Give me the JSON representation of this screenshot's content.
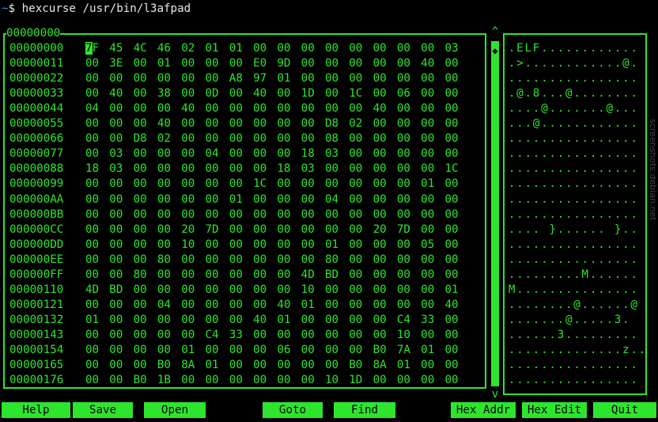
{
  "prompt": {
    "tilde": "~",
    "text": "$ hexcurse /usr/bin/l3afpad"
  },
  "hex_view": {
    "title": "00000000",
    "cursor": {
      "row": 0,
      "byte": 0,
      "char": "7"
    },
    "rows": [
      {
        "addr": "00000000",
        "bytes": [
          "7F",
          "45",
          "4C",
          "46",
          "02",
          "01",
          "01",
          "00",
          "00",
          "00",
          "00",
          "00",
          "00",
          "00",
          "00",
          "03"
        ],
        "ascii": ".ELF............"
      },
      {
        "addr": "00000011",
        "bytes": [
          "00",
          "3E",
          "00",
          "01",
          "00",
          "00",
          "00",
          "E0",
          "9D",
          "00",
          "00",
          "00",
          "00",
          "00",
          "40",
          "00"
        ],
        "ascii": ".>............@."
      },
      {
        "addr": "00000022",
        "bytes": [
          "00",
          "00",
          "00",
          "00",
          "00",
          "00",
          "A8",
          "97",
          "01",
          "00",
          "00",
          "00",
          "00",
          "00",
          "00",
          "00"
        ],
        "ascii": "................"
      },
      {
        "addr": "00000033",
        "bytes": [
          "00",
          "40",
          "00",
          "38",
          "00",
          "0D",
          "00",
          "40",
          "00",
          "1D",
          "00",
          "1C",
          "00",
          "06",
          "00",
          "00"
        ],
        "ascii": ".@.8...@........"
      },
      {
        "addr": "00000044",
        "bytes": [
          "04",
          "00",
          "00",
          "00",
          "40",
          "00",
          "00",
          "00",
          "00",
          "00",
          "00",
          "00",
          "40",
          "00",
          "00",
          "00"
        ],
        "ascii": "....@.......@..."
      },
      {
        "addr": "00000055",
        "bytes": [
          "00",
          "00",
          "00",
          "40",
          "00",
          "00",
          "00",
          "00",
          "00",
          "00",
          "D8",
          "02",
          "00",
          "00",
          "00",
          "00"
        ],
        "ascii": "...@............"
      },
      {
        "addr": "00000066",
        "bytes": [
          "00",
          "00",
          "D8",
          "02",
          "00",
          "00",
          "00",
          "00",
          "00",
          "00",
          "08",
          "00",
          "00",
          "00",
          "00",
          "00"
        ],
        "ascii": "................"
      },
      {
        "addr": "00000077",
        "bytes": [
          "00",
          "03",
          "00",
          "00",
          "00",
          "04",
          "00",
          "00",
          "00",
          "18",
          "03",
          "00",
          "00",
          "00",
          "00",
          "00"
        ],
        "ascii": "................"
      },
      {
        "addr": "00000088",
        "bytes": [
          "18",
          "03",
          "00",
          "00",
          "00",
          "00",
          "00",
          "00",
          "18",
          "03",
          "00",
          "00",
          "00",
          "00",
          "00",
          "1C"
        ],
        "ascii": "................"
      },
      {
        "addr": "00000099",
        "bytes": [
          "00",
          "00",
          "00",
          "00",
          "00",
          "00",
          "00",
          "1C",
          "00",
          "00",
          "00",
          "00",
          "00",
          "00",
          "01",
          "00"
        ],
        "ascii": "................"
      },
      {
        "addr": "000000AA",
        "bytes": [
          "00",
          "00",
          "00",
          "00",
          "00",
          "00",
          "01",
          "00",
          "00",
          "00",
          "04",
          "00",
          "00",
          "00",
          "00",
          "00"
        ],
        "ascii": "................"
      },
      {
        "addr": "000000BB",
        "bytes": [
          "00",
          "00",
          "00",
          "00",
          "00",
          "00",
          "00",
          "00",
          "00",
          "00",
          "00",
          "00",
          "00",
          "00",
          "00",
          "00"
        ],
        "ascii": "................"
      },
      {
        "addr": "000000CC",
        "bytes": [
          "00",
          "00",
          "00",
          "00",
          "20",
          "7D",
          "00",
          "00",
          "00",
          "00",
          "00",
          "00",
          "20",
          "7D",
          "00",
          "00"
        ],
        "ascii": ".... }...... }.."
      },
      {
        "addr": "000000DD",
        "bytes": [
          "00",
          "00",
          "00",
          "00",
          "10",
          "00",
          "00",
          "00",
          "00",
          "00",
          "01",
          "00",
          "00",
          "00",
          "05",
          "00"
        ],
        "ascii": "................"
      },
      {
        "addr": "000000EE",
        "bytes": [
          "00",
          "00",
          "00",
          "80",
          "00",
          "00",
          "00",
          "00",
          "00",
          "00",
          "80",
          "00",
          "00",
          "00",
          "00",
          "00"
        ],
        "ascii": "................"
      },
      {
        "addr": "000000FF",
        "bytes": [
          "00",
          "00",
          "80",
          "00",
          "00",
          "00",
          "00",
          "00",
          "00",
          "4D",
          "BD",
          "00",
          "00",
          "00",
          "00",
          "00"
        ],
        "ascii": ".........M......"
      },
      {
        "addr": "00000110",
        "bytes": [
          "4D",
          "BD",
          "00",
          "00",
          "00",
          "00",
          "00",
          "00",
          "00",
          "10",
          "00",
          "00",
          "00",
          "00",
          "00",
          "01"
        ],
        "ascii": "M..............."
      },
      {
        "addr": "00000121",
        "bytes": [
          "00",
          "00",
          "00",
          "04",
          "00",
          "00",
          "00",
          "00",
          "40",
          "01",
          "00",
          "00",
          "00",
          "00",
          "00",
          "40"
        ],
        "ascii": "........@......@"
      },
      {
        "addr": "00000132",
        "bytes": [
          "01",
          "00",
          "00",
          "00",
          "00",
          "00",
          "00",
          "40",
          "01",
          "00",
          "00",
          "00",
          "00",
          "C4",
          "33",
          "00"
        ],
        "ascii": ".......@.....3."
      },
      {
        "addr": "00000143",
        "bytes": [
          "00",
          "00",
          "00",
          "00",
          "00",
          "C4",
          "33",
          "00",
          "00",
          "00",
          "00",
          "00",
          "00",
          "10",
          "00",
          "00"
        ],
        "ascii": "......3........."
      },
      {
        "addr": "00000154",
        "bytes": [
          "00",
          "00",
          "00",
          "00",
          "01",
          "00",
          "00",
          "00",
          "06",
          "00",
          "00",
          "00",
          "B0",
          "7A",
          "01",
          "00"
        ],
        "ascii": "..............z.."
      },
      {
        "addr": "00000165",
        "bytes": [
          "00",
          "00",
          "00",
          "B0",
          "8A",
          "01",
          "00",
          "00",
          "00",
          "00",
          "00",
          "B0",
          "8A",
          "01",
          "00",
          "00"
        ],
        "ascii": "................"
      },
      {
        "addr": "00000176",
        "bytes": [
          "00",
          "00",
          "B0",
          "1B",
          "00",
          "00",
          "00",
          "00",
          "00",
          "00",
          "10",
          "1D",
          "00",
          "00",
          "00",
          "00"
        ],
        "ascii": "................"
      }
    ]
  },
  "scrollbar": {
    "up": "^",
    "down": "v",
    "thumb": "◆"
  },
  "function_keys": [
    {
      "id": "help",
      "label": "Help"
    },
    {
      "id": "save",
      "label": "Save"
    },
    {
      "id": "open",
      "label": "Open"
    },
    {
      "id": "goto",
      "label": "Goto"
    },
    {
      "id": "find",
      "label": "Find"
    },
    {
      "id": "hex-addr",
      "label": "Hex Addr"
    },
    {
      "id": "hex-edit",
      "label": "Hex Edit"
    },
    {
      "id": "quit",
      "label": "Quit"
    }
  ],
  "watermark": "screenshots.debian.net",
  "colors": {
    "fg": "#2ee52e",
    "bg": "#000000",
    "prompt_tilde": "#3a8ee6"
  }
}
